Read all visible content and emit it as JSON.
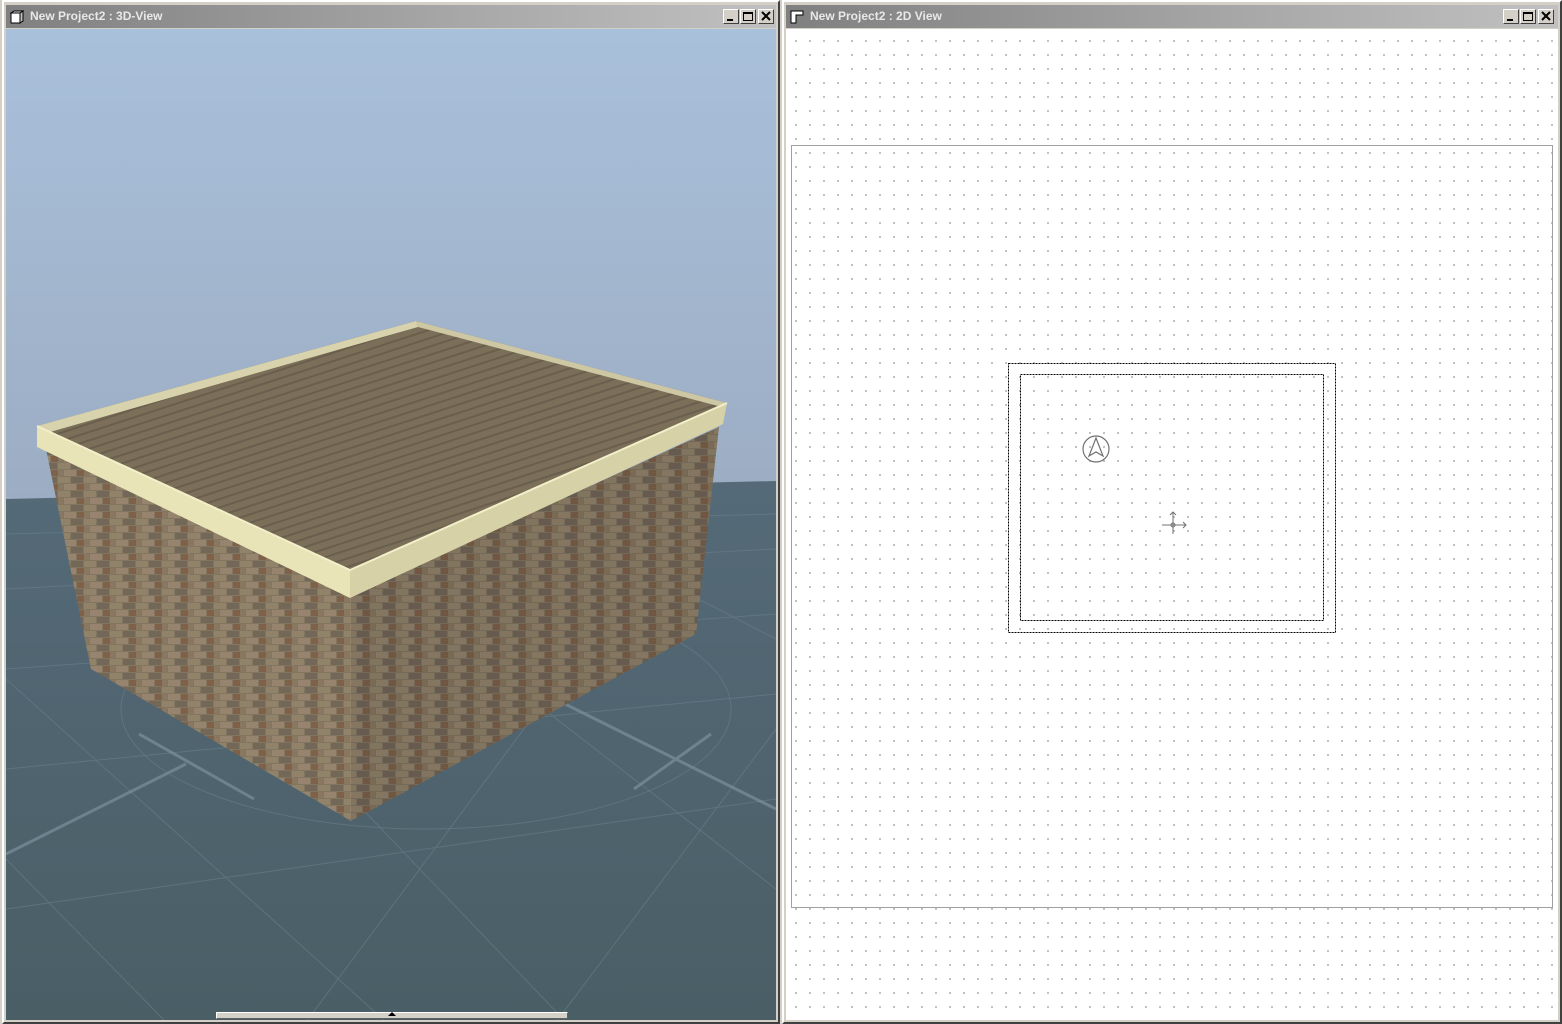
{
  "windows": {
    "view3d": {
      "title": "New Project2 : 3D-View",
      "icon": "3d-view-icon",
      "buttons": [
        "minimize",
        "maximize",
        "close"
      ]
    },
    "view2d": {
      "title": "New Project2 : 2D View",
      "icon": "2d-view-icon",
      "buttons": [
        "minimize",
        "maximize",
        "close"
      ]
    }
  },
  "colors": {
    "sky_top": "#a9c0db",
    "sky_bottom": "#9fb0c7",
    "ground": "#4f6470",
    "roof": "#7b6f5a",
    "roof_trim": "#e9e4b8",
    "brick": "#8e806a",
    "canvas_bg": "#ffffff",
    "grid_dot": "#b9b9b9"
  }
}
